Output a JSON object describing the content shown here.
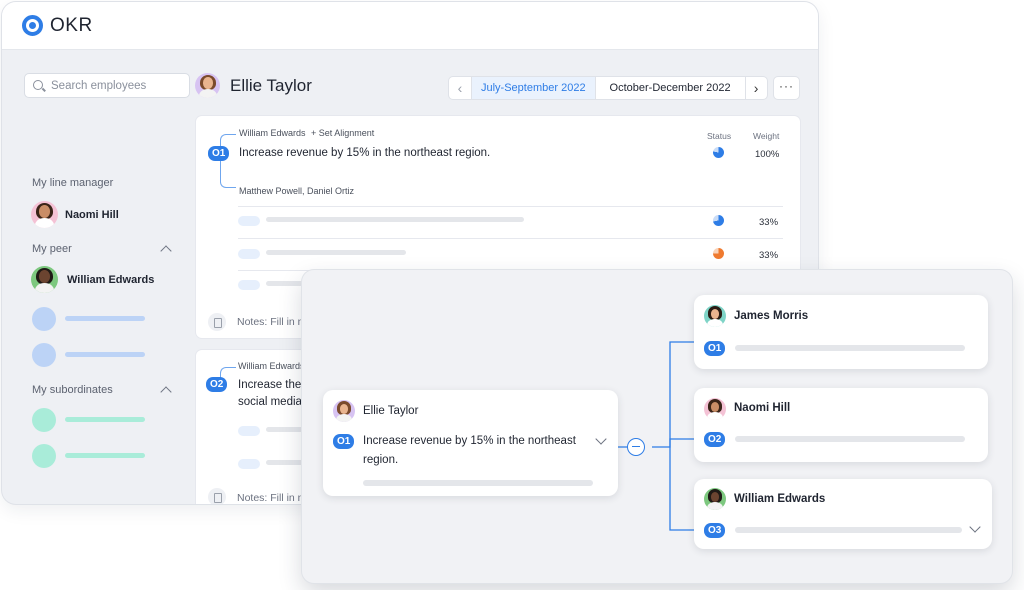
{
  "app": {
    "title": "OKR"
  },
  "colors": {
    "accent": "#2e7de6",
    "status_warning": "#ef7a2f"
  },
  "search": {
    "placeholder": "Search employees",
    "value": ""
  },
  "profile": {
    "name": "Ellie Taylor"
  },
  "periods": {
    "prev_icon": "chevron-left-icon",
    "next_icon": "chevron-right-icon",
    "items": [
      "July-September 2022",
      "October-December 2022"
    ],
    "active": "July-September 2022",
    "more_label": "···"
  },
  "sidebar": {
    "line_manager_label": "My line manager",
    "line_manager": "Naomi Hill",
    "peer_label": "My peer",
    "peer": "William Edwards",
    "subordinates_label": "My subordinates"
  },
  "objectives": [
    {
      "badge": "O1",
      "parent": "William Edwards",
      "set_alignment": "+ Set Alignment",
      "text": "Increase revenue by 15% in the northeast region.",
      "children": "Matthew Powell, Daniel Ortiz",
      "status_label": "Status",
      "weight_label": "Weight",
      "weight": "100%",
      "key_results": [
        {
          "weight": "33%",
          "status": "on-track"
        },
        {
          "weight": "33%",
          "status": "at-risk"
        }
      ],
      "notes": "Notes: Fill in n"
    },
    {
      "badge": "O2",
      "parent": "William Edwards",
      "text_line1": "Increase the",
      "text_line2": "social media",
      "notes": "Notes: Fill in n"
    }
  ],
  "alignment": {
    "source": {
      "name": "Ellie Taylor",
      "badge": "O1",
      "text_line1": "Increase revenue by 15% in the northeast",
      "text_line2": "region."
    },
    "targets": [
      {
        "name": "James Morris",
        "badge": "O1"
      },
      {
        "name": "Naomi Hill",
        "badge": "O2"
      },
      {
        "name": "William Edwards",
        "badge": "O3"
      }
    ]
  }
}
